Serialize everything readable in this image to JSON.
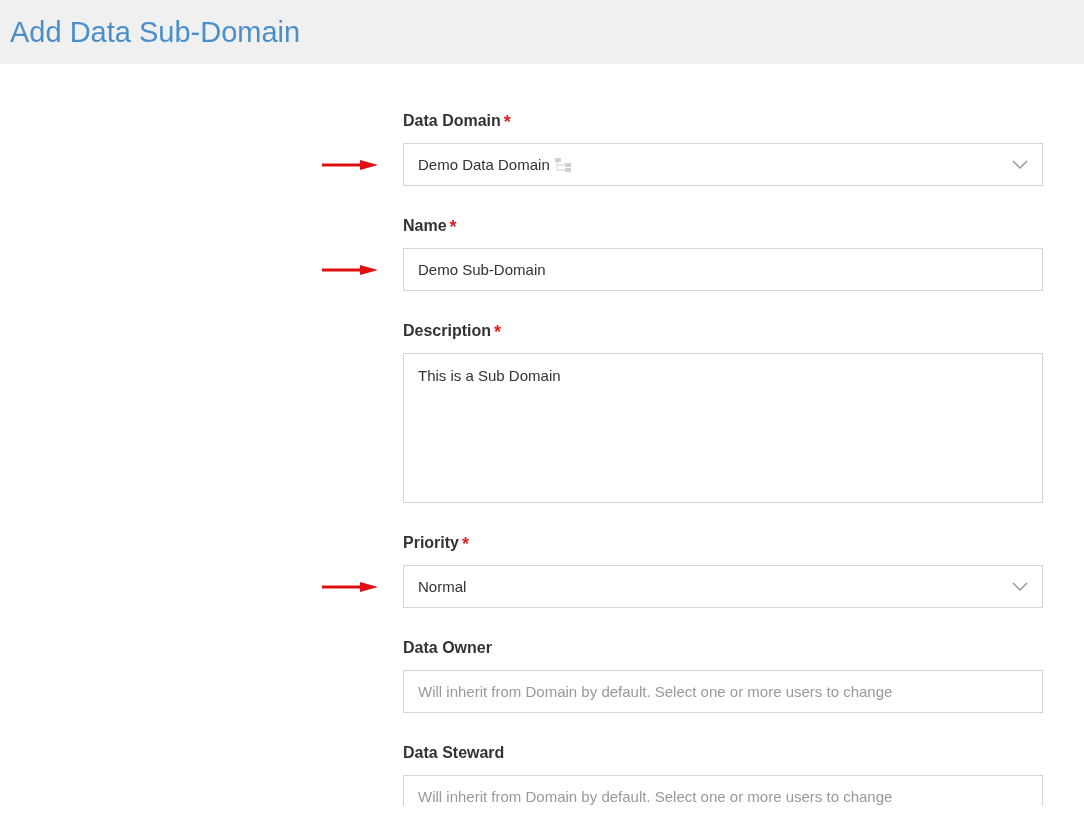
{
  "page": {
    "title": "Add Data Sub-Domain"
  },
  "fields": [
    {
      "kind": "select",
      "label": "Data Domain",
      "required_mark": "*",
      "value": "Demo Data Domain",
      "marked": true
    },
    {
      "kind": "text",
      "label": "Name",
      "required_mark": "*",
      "value": "Demo Sub-Domain",
      "marked": true
    },
    {
      "kind": "textarea",
      "label": "Description",
      "required_mark": "*",
      "value": "This is a Sub Domain",
      "marked": false
    },
    {
      "kind": "select",
      "label": "Priority",
      "required_mark": "*",
      "value": "Normal",
      "marked": true
    },
    {
      "kind": "people",
      "label": "Data Owner",
      "placeholder": "Will inherit from Domain by default. Select one or more users to change",
      "marked": false
    },
    {
      "kind": "people",
      "label": "Data Steward",
      "placeholder": "Will inherit from Domain by default. Select one or more users to change",
      "marked": false
    }
  ]
}
